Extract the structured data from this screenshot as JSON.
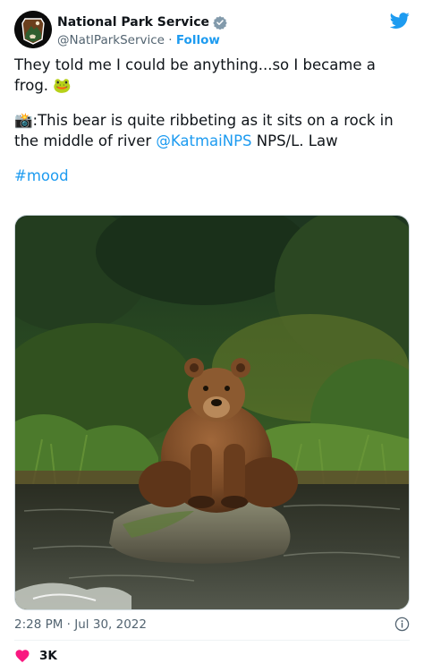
{
  "author": {
    "display_name": "National Park Service",
    "handle": "@NatlParkService",
    "separator": "·",
    "follow_label": "Follow",
    "verified": true
  },
  "tweet": {
    "line1": "They told me I could be anything...so I became a frog. 🐸",
    "line2_prefix": "📸:This bear is quite ribbeting as it sits on a rock in the middle of river ",
    "line2_mention": "@KatmaiNPS",
    "line2_suffix": " NPS/L. Law",
    "hashtag": "#mood"
  },
  "media": {
    "subject": "brown bear sitting on a rock in a river"
  },
  "meta": {
    "timestamp": "2:28 PM · Jul 30, 2022"
  },
  "engagement": {
    "likes": "3K"
  },
  "colors": {
    "accent": "#1d9bf0",
    "like": "#f91880",
    "text": "#0f1419",
    "secondary": "#536471"
  },
  "icons": {
    "verified": "verified-badge-icon",
    "brand": "twitter-bird-icon",
    "info": "info-icon",
    "like": "heart-icon"
  }
}
